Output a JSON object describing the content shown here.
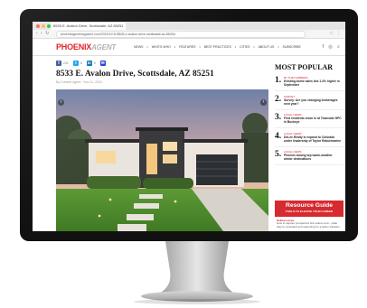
{
  "browser": {
    "tab_title": "8533 E. Avalon Drive, Scottsdale, AZ 85251",
    "url": "phoenixagentmagazine.com/2020/11/11/8533-e-avalon-drive-scottsdale-az-85251/"
  },
  "site": {
    "logo_main": "PHOENIX",
    "logo_sub": "AGENT",
    "nav": [
      "NEWS",
      "WHO'S WHO",
      "FEATURES",
      "BEST PRACTICES",
      "CITIES",
      "ABOUT US",
      "SUBSCRIBE"
    ]
  },
  "share": {
    "facebook_count": "231",
    "twitter_count": "6",
    "linkedin_count": "0"
  },
  "article": {
    "title": "8533 E. Avalon Drive, Scottsdale, AZ 85251",
    "byline": "By Content Agent    ·    Nov 11, 2020"
  },
  "sidebar": {
    "heading": "MOST POPULAR",
    "items": [
      {
        "num": "1.",
        "category": "By the Numbers",
        "text": "Existing-home sales tick 1.3% higher in September"
      },
      {
        "num": "2.",
        "category": "Survey",
        "text": "Survey: Are you changing brokerages next year?"
      },
      {
        "num": "3.",
        "category": "Local News",
        "text": "First residents move in at Townside HPC in Buckeye"
      },
      {
        "num": "4.",
        "category": "Local News",
        "text": "DeLex Realty is expand to Colorado under leadership of Taylor Rebuhmarine"
      },
      {
        "num": "5.",
        "category": "Local News",
        "text": "Phoenix among top warm-weather winter destinations"
      }
    ],
    "resource_title": "Resource Guide",
    "resource_sub": "TOOLS TO ELEVATE YOUR CAREER",
    "bottom_category": "Hellow Lucas",
    "bottom_text": "How to capture prospective first sellers and – what they're motivated and searching for a better situation"
  }
}
